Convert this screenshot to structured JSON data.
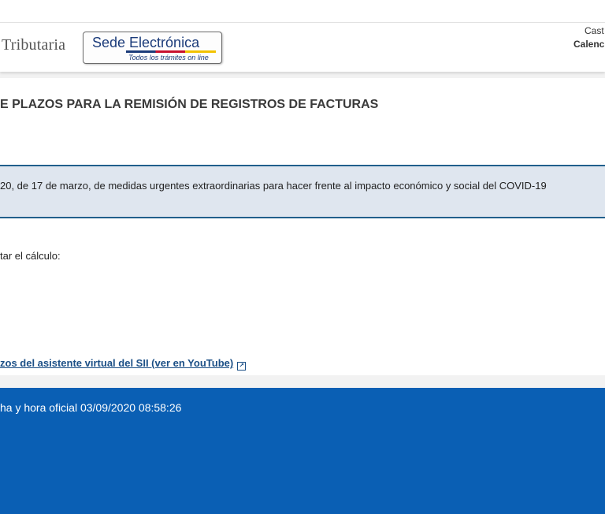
{
  "header": {
    "brand_text": "Tributaria",
    "sede": {
      "title": "Sede Electrónica",
      "subtitle": "Todos los trámites on line"
    },
    "language_link": "Cast",
    "calendar_link": "Calenc"
  },
  "main": {
    "title": "E PLAZOS PARA LA REMISIÓN DE REGISTROS DE FACTURAS",
    "notice_text": "20, de 17 de marzo, de medidas urgentes extraordinarias para hacer frente al impacto económico y social del COVID-19",
    "calc_text": "tar el cálculo:",
    "video_link": "zos del asistente virtual del SII (ver en YouTube)",
    "external_icon": "external-link-icon"
  },
  "footer": {
    "text": "ha y hora oficial 03/09/2020 08:58:26"
  },
  "colors": {
    "footer_bg": "#0a5fb4",
    "notice_bg": "#dfe6ef",
    "notice_border": "#215f8c",
    "link": "#1b4f86"
  }
}
